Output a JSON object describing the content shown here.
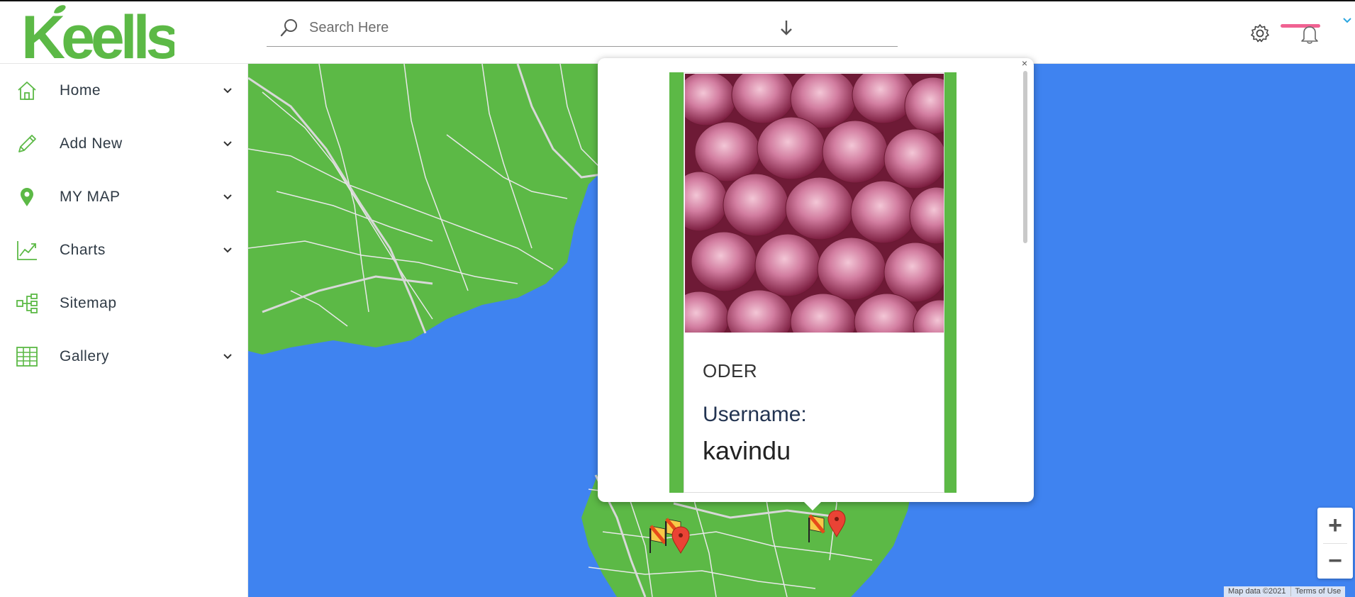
{
  "header": {
    "logo_text": "Keells",
    "search": {
      "placeholder": "Search Here"
    }
  },
  "sidebar": {
    "items": [
      {
        "label": "Home",
        "icon": "home-icon",
        "has_chevron": true
      },
      {
        "label": "Add New",
        "icon": "pencil-icon",
        "has_chevron": true
      },
      {
        "label": "MY MAP",
        "icon": "map-pin-icon",
        "has_chevron": true
      },
      {
        "label": "Charts",
        "icon": "line-chart-icon",
        "has_chevron": true
      },
      {
        "label": "Sitemap",
        "icon": "sitemap-icon",
        "has_chevron": false
      },
      {
        "label": "Gallery",
        "icon": "grid-icon",
        "has_chevron": true
      }
    ]
  },
  "popup": {
    "close_label": "×",
    "card": {
      "title": "ODER",
      "username_label": "Username:",
      "username_value": "kavindu"
    }
  },
  "map": {
    "zoom_in": "+",
    "zoom_out": "−",
    "attribution": {
      "map_data": "Map data ©2021",
      "terms": "Terms of Use"
    }
  },
  "colors": {
    "brand_green": "#5cb946",
    "map_water": "#3f83f0",
    "map_land": "#5cb946",
    "notification_bar": "#f06292"
  }
}
